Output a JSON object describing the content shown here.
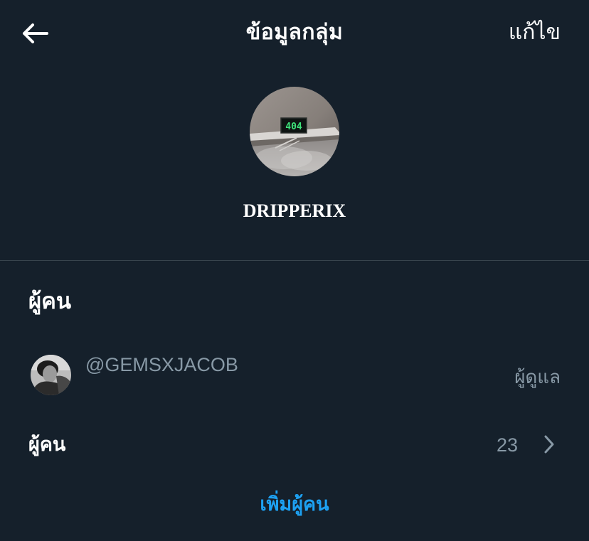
{
  "header": {
    "title": "ข้อมูลกลุ่ม",
    "edit_label": "แก้ไข",
    "back_icon": "arrow-left-icon"
  },
  "group": {
    "name": "DRIPPERIX",
    "avatar_sign_text": "404"
  },
  "people_section": {
    "title": "ผู้คน",
    "members": [
      {
        "handle": "@GEMSXJACOB",
        "role": "ผู้ดูแล"
      }
    ],
    "people_row_label": "ผู้คน",
    "people_count": "23",
    "chevron_icon": "chevron-right-icon",
    "add_people_label": "เพิ่มผู้คน"
  },
  "colors": {
    "background": "#15202b",
    "divider": "#38444d",
    "muted_text": "#8899a6",
    "accent": "#1da1f2",
    "text": "#ffffff"
  }
}
